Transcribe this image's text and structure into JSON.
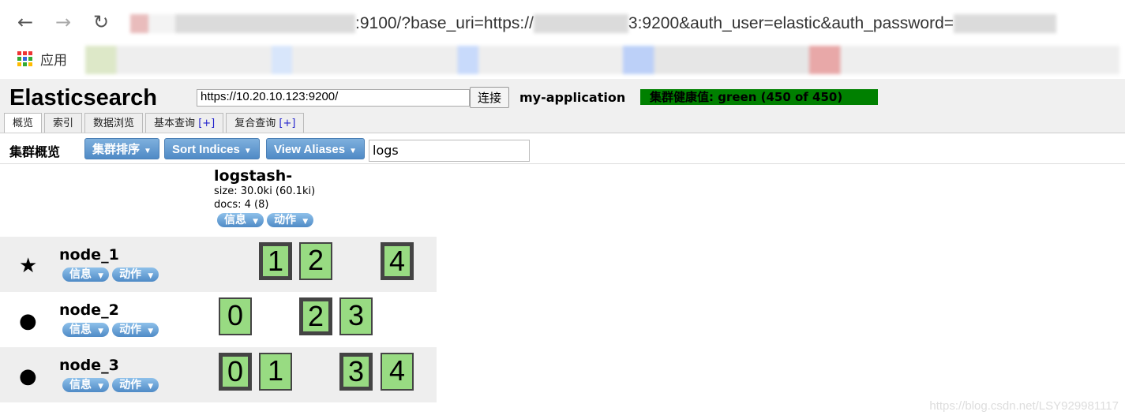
{
  "browser": {
    "url_visible_1": ":9100/?base_uri=https://",
    "url_visible_2": "3:9200&auth_user=elastic&auth_password=",
    "apps_label": "应用"
  },
  "header": {
    "logo": "Elasticsearch",
    "connect_url": "https://10.20.10.123:9200/",
    "connect_label": "连接",
    "cluster_name": "my-application",
    "health": "集群健康值: green (450 of 450)",
    "health_color": "#008000"
  },
  "tabs": [
    {
      "label": "概览",
      "active": true
    },
    {
      "label": "索引"
    },
    {
      "label": "数据浏览"
    },
    {
      "label": "基本查询",
      "plus": "[+]"
    },
    {
      "label": "复合查询",
      "plus": "[+]"
    }
  ],
  "toolbar": {
    "title": "集群概览",
    "sort_cluster": "集群排序",
    "sort_indices": "Sort Indices",
    "view_aliases": "View Aliases",
    "filter_value": "logs"
  },
  "index": {
    "name": "logstash-",
    "size": "size: 30.0ki (60.1ki)",
    "docs": "docs: 4 (8)",
    "info": "信息",
    "action": "动作"
  },
  "nodes": [
    {
      "name": "node_1",
      "icon": "star-icon",
      "info": "信息",
      "action": "动作",
      "shards": [
        {
          "n": "1",
          "primary": true
        },
        {
          "n": "2",
          "primary": false
        },
        {
          "n": "4",
          "primary": true
        }
      ]
    },
    {
      "name": "node_2",
      "icon": "circle-icon",
      "info": "信息",
      "action": "动作",
      "shards": [
        {
          "n": "0",
          "primary": false
        },
        {
          "n": "2",
          "primary": true
        },
        {
          "n": "3",
          "primary": false
        }
      ]
    },
    {
      "name": "node_3",
      "icon": "circle-icon",
      "info": "信息",
      "action": "动作",
      "shards": [
        {
          "n": "0",
          "primary": true
        },
        {
          "n": "1",
          "primary": false
        },
        {
          "n": "3",
          "primary": true
        },
        {
          "n": "4",
          "primary": false
        }
      ]
    }
  ],
  "watermark": "https://blog.csdn.net/LSY929981117"
}
